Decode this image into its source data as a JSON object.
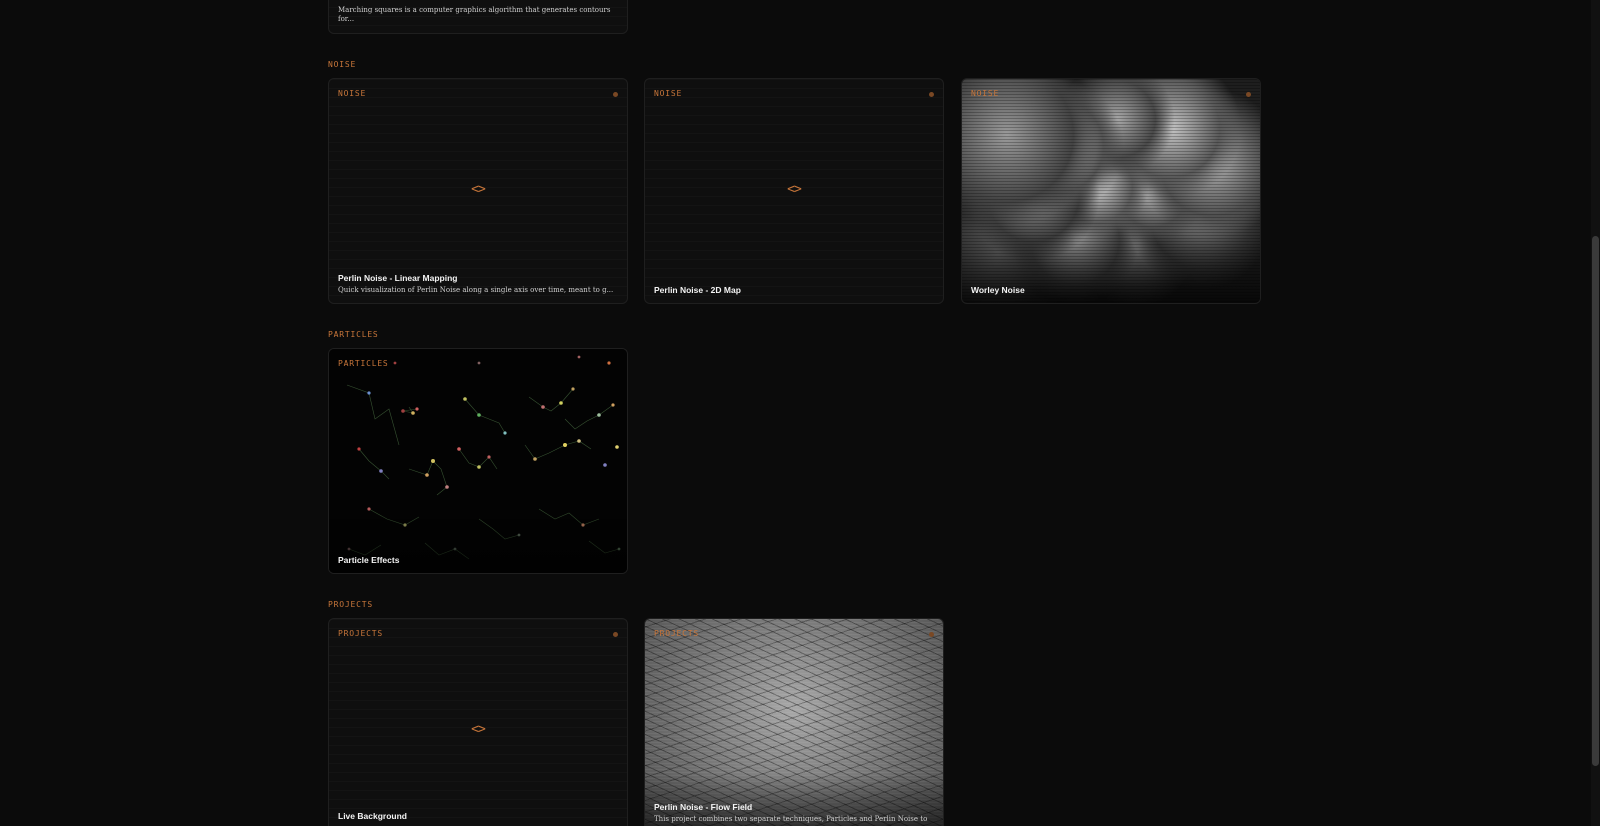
{
  "top_card": {
    "desc": "Marching squares is a computer graphics algorithm that generates contours for..."
  },
  "sections": {
    "noise": {
      "label": "NOISE",
      "cards": [
        {
          "tag": "NOISE",
          "title": "Perlin Noise - Linear Mapping",
          "desc": "Quick visualization of Perlin Noise along a single axis over time, meant to g...",
          "icon": "code-icon"
        },
        {
          "tag": "NOISE",
          "title": "Perlin Noise - 2D Map",
          "icon": "code-icon"
        },
        {
          "tag": "NOISE",
          "title": "Worley Noise",
          "preview": "worley-noise-image"
        }
      ]
    },
    "particles": {
      "label": "PARTICLES",
      "cards": [
        {
          "tag": "PARTICLES",
          "title": "Particle Effects",
          "preview": "particle-network-image"
        }
      ]
    },
    "projects": {
      "label": "PROJECTS",
      "cards": [
        {
          "tag": "PROJECTS",
          "title": "Live Background",
          "icon": "code-icon"
        },
        {
          "tag": "PROJECTS",
          "title": "Perlin Noise - Flow Field",
          "desc": "This project combines two separate techniques, Particles and Perlin Noise to",
          "preview": "flow-field-image"
        }
      ]
    }
  },
  "code_glyph": "<>",
  "colors": {
    "accent": "#c8763a",
    "background": "#0b0b0b",
    "card": "#0f0f0f"
  }
}
